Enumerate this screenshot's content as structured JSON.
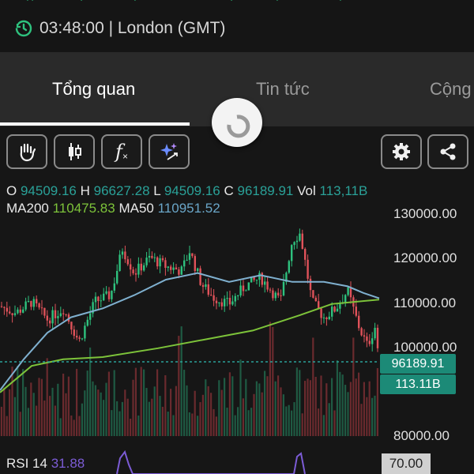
{
  "header": {
    "price_partial": "",
    "time_label": "03:48:00 | London (GMT)"
  },
  "tabs": [
    {
      "label": "Tổng quan",
      "active": true
    },
    {
      "label": "Tin tức",
      "active": false
    },
    {
      "label": "Cộng",
      "active": false
    }
  ],
  "toolbar": {
    "tools": [
      "hand-icon",
      "candles-icon",
      "function-icon",
      "ai-sparkle-icon"
    ],
    "actions": [
      "settings-icon",
      "share-icon"
    ],
    "function_glyph": "f"
  },
  "ohlc": {
    "o_label": "O",
    "o_value": "94509.16",
    "h_label": "H",
    "h_value": "96627.28",
    "l_label": "L",
    "l_value": "94509.16",
    "c_label": "C",
    "c_value": "96189.91",
    "vol_label": "Vol",
    "vol_value": "113,11B"
  },
  "ma": {
    "ma200_label": "MA200",
    "ma200_value": "110475.83",
    "ma50_label": "MA50",
    "ma50_value": "110951.52"
  },
  "y_axis": {
    "ticks": [
      "130000.00",
      "120000.00",
      "110000.00",
      "100000.00",
      "80000.00"
    ]
  },
  "price_tag": "96189.91",
  "volume_tag": "113.11B",
  "rsi": {
    "label": "RSI 14",
    "value": "31.88",
    "level": "70.00"
  },
  "colors": {
    "up": "#2ec27e",
    "down": "#e0525a",
    "ma200": "#7dc33a",
    "ma50": "#7fb0cf",
    "price_line": "#2aa198",
    "rsi": "#7c5cd6"
  }
}
